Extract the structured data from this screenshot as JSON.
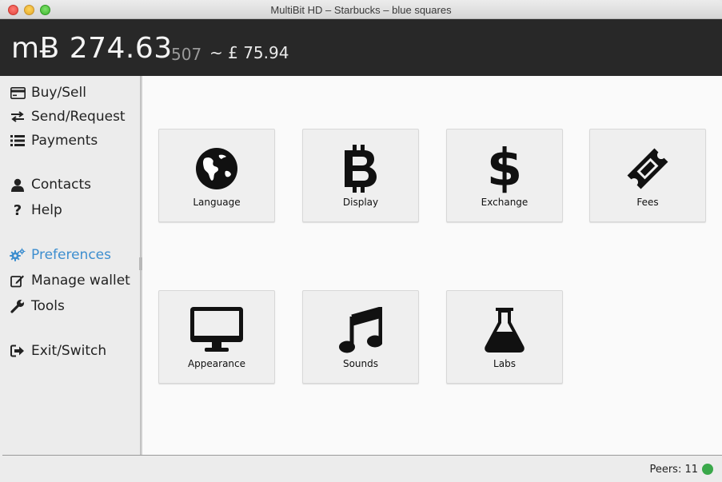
{
  "window": {
    "title": "MultiBit HD – Starbucks – blue squares"
  },
  "balance": {
    "primary": "mɃ 274.63",
    "secondary": "507",
    "fiat": "~ £ 75.94"
  },
  "sidebar": {
    "items": [
      {
        "label": "Buy/Sell",
        "icon": "credit-card-icon"
      },
      {
        "label": "Send/Request",
        "icon": "exchange-arrows-icon"
      },
      {
        "label": "Payments",
        "icon": "list-icon"
      },
      {
        "label": "Contacts",
        "icon": "user-icon"
      },
      {
        "label": "Help",
        "icon": "question-icon"
      },
      {
        "label": "Preferences",
        "icon": "gears-icon",
        "active": true
      },
      {
        "label": "Manage wallet",
        "icon": "edit-icon"
      },
      {
        "label": "Tools",
        "icon": "wrench-icon"
      },
      {
        "label": "Exit/Switch",
        "icon": "sign-out-icon"
      }
    ],
    "active_color": "#3d8ecf"
  },
  "preferences": {
    "tiles": [
      {
        "label": "Language",
        "icon": "globe-icon"
      },
      {
        "label": "Display",
        "icon": "bitcoin-icon"
      },
      {
        "label": "Exchange",
        "icon": "dollar-icon"
      },
      {
        "label": "Fees",
        "icon": "ticket-icon"
      },
      {
        "label": "Appearance",
        "icon": "desktop-icon"
      },
      {
        "label": "Sounds",
        "icon": "music-icon"
      },
      {
        "label": "Labs",
        "icon": "flask-icon"
      }
    ]
  },
  "status": {
    "peers": "Peers: 11",
    "peer_status_color": "#3aa84a"
  }
}
